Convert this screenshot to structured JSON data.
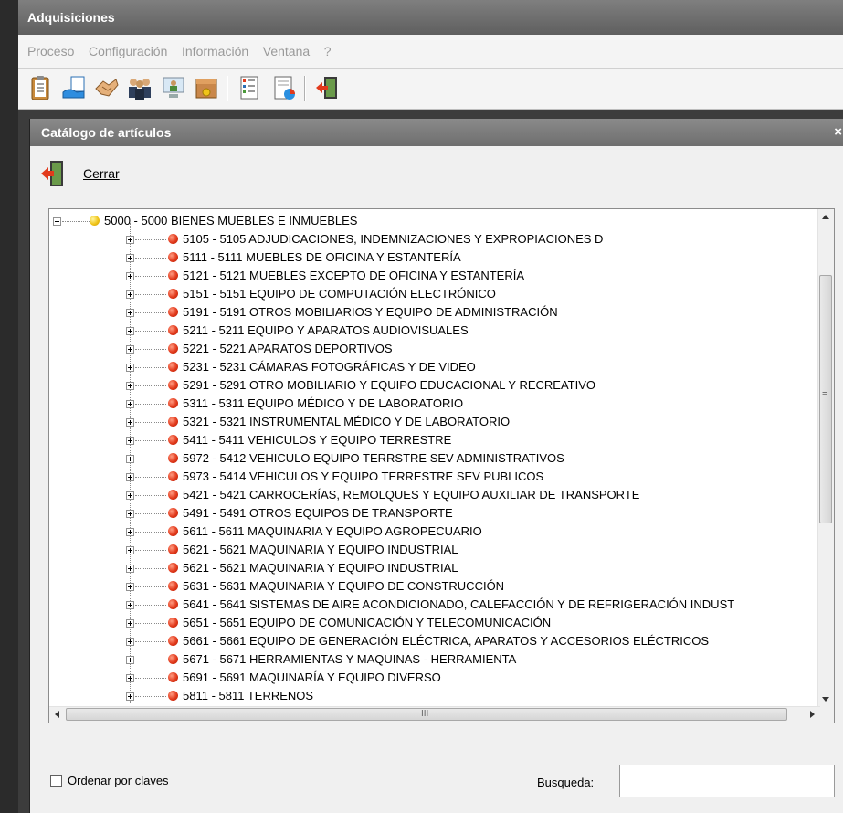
{
  "app": {
    "title": "Adquisiciones"
  },
  "menu": [
    "Proceso",
    "Configuración",
    "Información",
    "Ventana",
    "?"
  ],
  "toolbar": {
    "icons": [
      "clipboard-icon",
      "hand-document-icon",
      "handshake-icon",
      "people-icon",
      "user-screen-icon",
      "box-icon",
      "list-icon",
      "report-icon",
      "exit-icon"
    ]
  },
  "child": {
    "title": "Catálogo de artículos",
    "close_glyph": "×",
    "close_label": "Cerrar"
  },
  "tree": {
    "root": "5000 - 5000 BIENES MUEBLES E INMUEBLES",
    "items": [
      "5105 - 5105 ADJUDICACIONES, INDEMNIZACIONES Y EXPROPIACIONES D",
      "5111 - 5111  MUEBLES DE OFICINA Y ESTANTERÍA",
      "5121 - 5121 MUEBLES EXCEPTO DE OFICINA Y ESTANTERÍA",
      "5151 - 5151 EQUIPO DE COMPUTACIÓN ELECTRÓNICO",
      "5191 - 5191 OTROS MOBILIARIOS Y EQUIPO DE ADMINISTRACIÓN",
      "5211 - 5211 EQUIPO Y APARATOS AUDIOVISUALES",
      "5221 - 5221 APARATOS DEPORTIVOS",
      "5231 - 5231 CÁMARAS FOTOGRÁFICAS Y DE VIDEO",
      "5291 - 5291 OTRO MOBILIARIO Y EQUIPO EDUCACIONAL Y RECREATIVO",
      "5311 - 5311 EQUIPO MÉDICO Y DE LABORATORIO",
      "5321 - 5321 INSTRUMENTAL MÉDICO Y DE LABORATORIO",
      "5411 - 5411 VEHICULOS Y EQUIPO TERRESTRE",
      "5972 - 5412 VEHICULO  EQUIPO TERRSTRE SEV ADMINISTRATIVOS",
      "5973 - 5414 VEHICULOS Y EQUIPO TERRESTRE SEV PUBLICOS",
      "5421 - 5421 CARROCERÍAS, REMOLQUES Y EQUIPO AUXILIAR DE TRANSPORTE",
      "5491 - 5491 OTROS EQUIPOS DE TRANSPORTE",
      "5611 - 5611 MAQUINARIA Y EQUIPO AGROPECUARIO",
      "5621 - 5621  MAQUINARIA Y EQUIPO INDUSTRIAL",
      "5621 - 5621 MAQUINARIA Y EQUIPO INDUSTRIAL",
      "5631 - 5631 MAQUINARIA Y EQUIPO DE CONSTRUCCIÓN",
      "5641 - 5641  SISTEMAS DE AIRE ACONDICIONADO, CALEFACCIÓN Y DE REFRIGERACIÓN INDUST",
      "5651 - 5651 EQUIPO DE COMUNICACIÓN Y TELECOMUNICACIÓN",
      "5661 - 5661 EQUIPO DE GENERACIÓN ELÉCTRICA, APARATOS Y ACCESORIOS ELÉCTRICOS",
      "5671 - 5671 HERRAMIENTAS Y MAQUINAS - HERRAMIENTA",
      "5691 - 5691 MAQUINARÍA Y EQUIPO DIVERSO",
      "5811 - 5811 TERRENOS"
    ]
  },
  "scrollbar": {
    "grip": "≡",
    "hgrip": "III"
  },
  "footer": {
    "order_label": "Ordenar por claves",
    "order_checked": false,
    "search_label": "Busqueda:",
    "search_value": ""
  },
  "colors": {
    "bullet_root": "#f0c419",
    "bullet_item": "#e23a1c",
    "titlebar": "#6e6e6e"
  }
}
